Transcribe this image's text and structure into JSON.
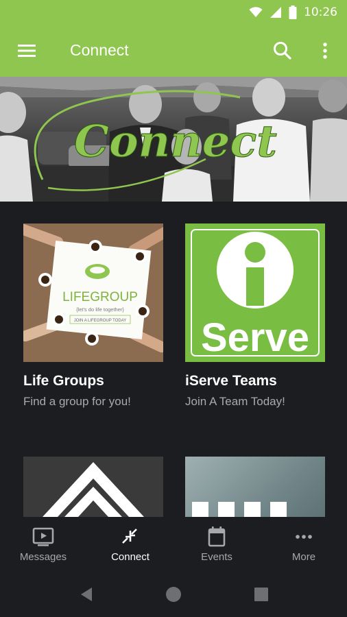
{
  "status_bar": {
    "time": "10:26",
    "icons": [
      "wifi-icon",
      "cell-signal-icon",
      "battery-icon"
    ]
  },
  "app_bar": {
    "title": "Connect",
    "menu_icon": "hamburger-menu-icon",
    "search_icon": "search-icon",
    "overflow_icon": "more-vert-icon"
  },
  "hero": {
    "script_text": "Connect"
  },
  "cards": [
    {
      "title": "Life Groups",
      "subtitle": "Find a group for you!",
      "image_logo": "LIFEGROUP",
      "image_tagline": "{let's do life together}",
      "image_cta": "JOIN A LIFEGROUP TODAY"
    },
    {
      "title": "iServe Teams",
      "subtitle": "Join A Team Today!",
      "image_logo": "Serve"
    },
    {},
    {}
  ],
  "bottom_nav": [
    {
      "label": "Messages",
      "icon": "video-play-icon",
      "active": false
    },
    {
      "label": "Connect",
      "icon": "collapse-arrows-icon",
      "active": true
    },
    {
      "label": "Events",
      "icon": "calendar-icon",
      "active": false
    },
    {
      "label": "More",
      "icon": "more-horiz-icon",
      "active": false
    }
  ],
  "system_nav": [
    "back-icon",
    "home-icon",
    "recents-icon"
  ],
  "colors": {
    "accent": "#8fc64f",
    "background": "#1c1d20",
    "iserve_green": "#79bd43",
    "muted_text": "#a9aaae"
  }
}
